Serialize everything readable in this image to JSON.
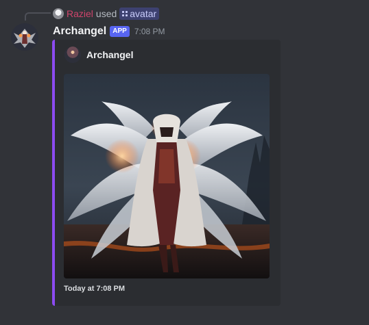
{
  "interaction": {
    "user": "Raziel",
    "used": "used",
    "command": "avatar"
  },
  "message": {
    "author": "Archangel",
    "badge": "APP",
    "timestamp": "7:08 PM"
  },
  "embed": {
    "author_name": "Archangel",
    "image_icon": "archangel-artwork",
    "footer": "Today at 7:08 PM",
    "accent_color": "#8c4bf2"
  },
  "colors": {
    "background": "#313338",
    "embed_background": "#2b2d31",
    "username_color": "#d0446b",
    "app_badge": "#5865f2"
  }
}
